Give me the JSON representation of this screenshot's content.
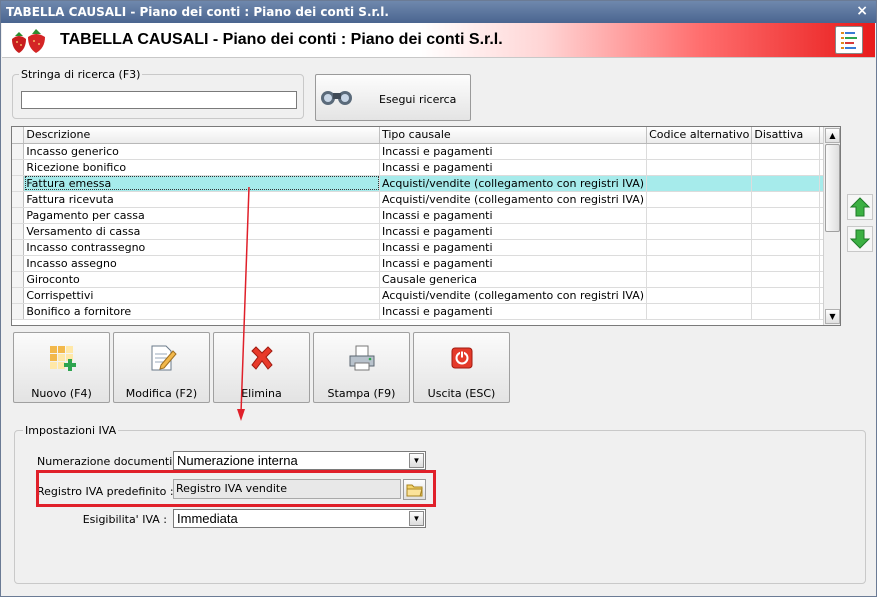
{
  "window": {
    "title": "TABELLA CAUSALI - Piano dei conti : Piano dei conti S.r.l.",
    "close_glyph": "×"
  },
  "banner": {
    "title": "TABELLA CAUSALI - Piano dei conti : Piano dei conti S.r.l.",
    "logo_icon": "strawberries-icon",
    "menu_icon": "list-menu-icon"
  },
  "search": {
    "legend": "Stringa di ricerca (F3)",
    "value": "",
    "placeholder": "",
    "button_label": "Esegui ricerca",
    "button_icon": "binoculars-icon"
  },
  "grid": {
    "columns": [
      "Descrizione",
      "Tipo causale",
      "Codice alternativo",
      "Disattiva"
    ],
    "rows": [
      {
        "descrizione": "Incasso generico",
        "tipo": "Incassi e pagamenti",
        "codice": "",
        "disattiva": ""
      },
      {
        "descrizione": "Ricezione bonifico",
        "tipo": "Incassi e pagamenti",
        "codice": "",
        "disattiva": ""
      },
      {
        "descrizione": "Fattura emessa",
        "tipo": "Acquisti/vendite (collegamento con registri IVA)",
        "codice": "",
        "disattiva": ""
      },
      {
        "descrizione": "Fattura ricevuta",
        "tipo": "Acquisti/vendite (collegamento con registri IVA)",
        "codice": "",
        "disattiva": ""
      },
      {
        "descrizione": "Pagamento per cassa",
        "tipo": "Incassi e pagamenti",
        "codice": "",
        "disattiva": ""
      },
      {
        "descrizione": "Versamento di cassa",
        "tipo": "Incassi e pagamenti",
        "codice": "",
        "disattiva": ""
      },
      {
        "descrizione": "Incasso contrassegno",
        "tipo": "Incassi e pagamenti",
        "codice": "",
        "disattiva": ""
      },
      {
        "descrizione": "Incasso assegno",
        "tipo": "Incassi e pagamenti",
        "codice": "",
        "disattiva": ""
      },
      {
        "descrizione": "Giroconto",
        "tipo": "Causale generica",
        "codice": "",
        "disattiva": ""
      },
      {
        "descrizione": "Corrispettivi",
        "tipo": "Acquisti/vendite (collegamento con registri IVA)",
        "codice": "",
        "disattiva": ""
      },
      {
        "descrizione": "Bonifico a fornitore",
        "tipo": "Incassi e pagamenti",
        "codice": "",
        "disattiva": ""
      }
    ],
    "selected_row": 2
  },
  "side_buttons": {
    "up_icon": "green-arrow-up-icon",
    "down_icon": "green-arrow-down-icon"
  },
  "toolbar": {
    "nuovo": "Nuovo (F4)",
    "modifica": "Modifica (F2)",
    "elimina": "Elimina",
    "stampa": "Stampa (F9)",
    "uscita": "Uscita (ESC)"
  },
  "iva": {
    "legend": "Impostazioni IVA",
    "numerazione_label": "Numerazione documenti :",
    "numerazione_value": "Numerazione interna",
    "registro_label": "Registro IVA predefinito :",
    "registro_value": "Registro IVA vendite",
    "esigibilita_label": "Esigibilita' IVA :",
    "esigibilita_value": "Immediata"
  },
  "colors": {
    "selected_row": "#a6ebeb",
    "highlight": "#e0202a",
    "title_bar": "#4a6590"
  }
}
